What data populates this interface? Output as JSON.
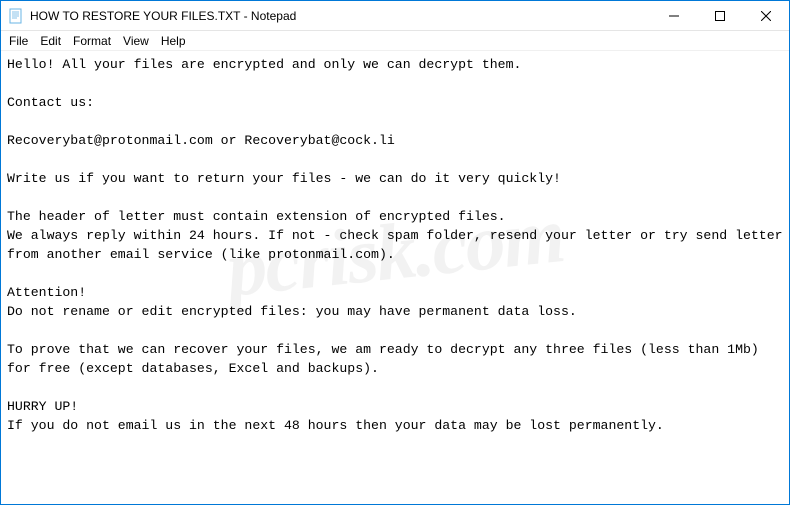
{
  "titlebar": {
    "title": "HOW TO RESTORE YOUR FILES.TXT - Notepad"
  },
  "menubar": {
    "items": [
      "File",
      "Edit",
      "Format",
      "View",
      "Help"
    ]
  },
  "content": {
    "text": "Hello! All your files are encrypted and only we can decrypt them.\n\nContact us:\n\nRecoverybat@protonmail.com or Recoverybat@cock.li\n\nWrite us if you want to return your files - we can do it very quickly!\n\nThe header of letter must contain extension of encrypted files.\nWe always reply within 24 hours. If not - check spam folder, resend your letter or try send letter from another email service (like protonmail.com).\n\nAttention!\nDo not rename or edit encrypted files: you may have permanent data loss.\n\nTo prove that we can recover your files, we am ready to decrypt any three files (less than 1Mb) for free (except databases, Excel and backups).\n\nHURRY UP!\nIf you do not email us in the next 48 hours then your data may be lost permanently."
  },
  "watermark": {
    "text": "pcrisk.com"
  }
}
